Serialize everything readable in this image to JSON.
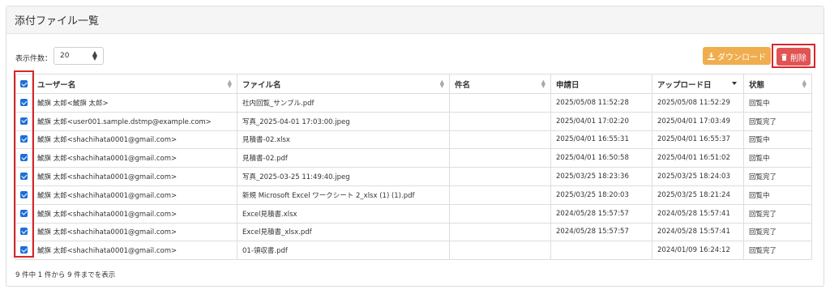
{
  "card": {
    "title": "添付ファイル一覧"
  },
  "toolbar": {
    "page_size_label": "表示件数：",
    "page_size_value": "20",
    "download_label": "ダウンロード",
    "delete_label": "削除"
  },
  "table": {
    "columns": [
      "ユーザー名",
      "ファイル名",
      "件名",
      "申請日",
      "アップロード日",
      "状態"
    ],
    "rows": [
      {
        "user": "鯱旗 太郎<鯱旗 太郎>",
        "file": "社内回覧_サンプル.pdf",
        "subject": "",
        "applied": "2025/05/08 11:52:28",
        "uploaded": "2025/05/08 11:52:29",
        "status": "回覧中"
      },
      {
        "user": "鯱旗 太郎<user001.sample.dstmp@example.com>",
        "file": "写真_2025-04-01 17:03:00.jpeg",
        "subject": "",
        "applied": "2025/04/01 17:02:20",
        "uploaded": "2025/04/01 17:03:49",
        "status": "回覧完了"
      },
      {
        "user": "鯱旗 太郎<shachihata0001@gmail.com>",
        "file": "見積書-02.xlsx",
        "subject": "",
        "applied": "2025/04/01 16:55:31",
        "uploaded": "2025/04/01 16:55:37",
        "status": "回覧中"
      },
      {
        "user": "鯱旗 太郎<shachihata0001@gmail.com>",
        "file": "見積書-02.pdf",
        "subject": "",
        "applied": "2025/04/01 16:50:58",
        "uploaded": "2025/04/01 16:51:02",
        "status": "回覧中"
      },
      {
        "user": "鯱旗 太郎<shachihata0001@gmail.com>",
        "file": "写真_2025-03-25 11:49:40.jpeg",
        "subject": "",
        "applied": "2025/03/25 18:23:36",
        "uploaded": "2025/03/25 18:24:03",
        "status": "回覧完了"
      },
      {
        "user": "鯱旗 太郎<shachihata0001@gmail.com>",
        "file": "新規 Microsoft Excel ワークシート 2_xlsx (1) (1).pdf",
        "subject": "",
        "applied": "2025/03/25 18:20:03",
        "uploaded": "2025/03/25 18:21:24",
        "status": "回覧中"
      },
      {
        "user": "鯱旗 太郎<shachihata0001@gmail.com>",
        "file": "Excel見積書.xlsx",
        "subject": "",
        "applied": "2024/05/28 15:57:57",
        "uploaded": "2024/05/28 15:57:41",
        "status": "回覧完了"
      },
      {
        "user": "鯱旗 太郎<shachihata0001@gmail.com>",
        "file": "Excel見積書_xlsx.pdf",
        "subject": "",
        "applied": "2024/05/28 15:57:57",
        "uploaded": "2024/05/28 15:57:41",
        "status": "回覧完了"
      },
      {
        "user": "鯱旗 太郎<shachihata0001@gmail.com>",
        "file": "01-領収書.pdf",
        "subject": "",
        "applied": "",
        "uploaded": "2024/01/09 16:24:12",
        "status": "回覧完了"
      }
    ]
  },
  "footer": {
    "info": "9 件中 1 件から 9 件までを表示"
  },
  "colors": {
    "download": "#f0ad4e",
    "delete": "#e05454",
    "checkbox": "#1f6fd6",
    "highlight": "#d9262a"
  }
}
